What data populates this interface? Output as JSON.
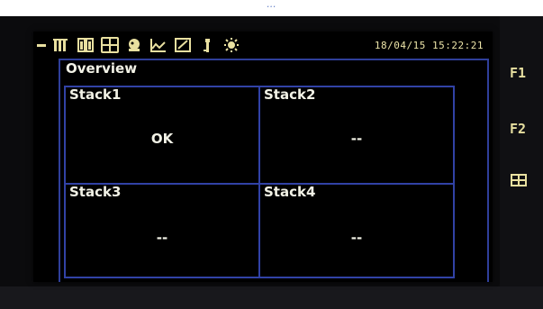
{
  "caption": "...",
  "toolbar": {
    "icons": [
      {
        "name": "dash-icon"
      },
      {
        "name": "single-bars-icon"
      },
      {
        "name": "double-bars-icon"
      },
      {
        "name": "overview-grid-icon",
        "active": true
      },
      {
        "name": "alarm-bell-icon"
      },
      {
        "name": "trend-chart-icon"
      },
      {
        "name": "checklist-icon"
      },
      {
        "name": "tool-icon"
      },
      {
        "name": "sun-icon"
      }
    ],
    "datetime": "18/04/15 15:22:21"
  },
  "overview": {
    "title": "Overview",
    "stacks": [
      {
        "name": "Stack1",
        "status": "OK"
      },
      {
        "name": "Stack2",
        "status": "--"
      },
      {
        "name": "Stack3",
        "status": "--"
      },
      {
        "name": "Stack4",
        "status": "--"
      }
    ]
  },
  "softkeys": {
    "f1": "F1",
    "f2": "F2",
    "f3_icon": "overview-grid-icon"
  },
  "colors": {
    "frame_blue": "#3142a6",
    "text": "#f2f2e6",
    "icon_yellow": "#e9e0a0",
    "screen_bg": "#000000"
  }
}
